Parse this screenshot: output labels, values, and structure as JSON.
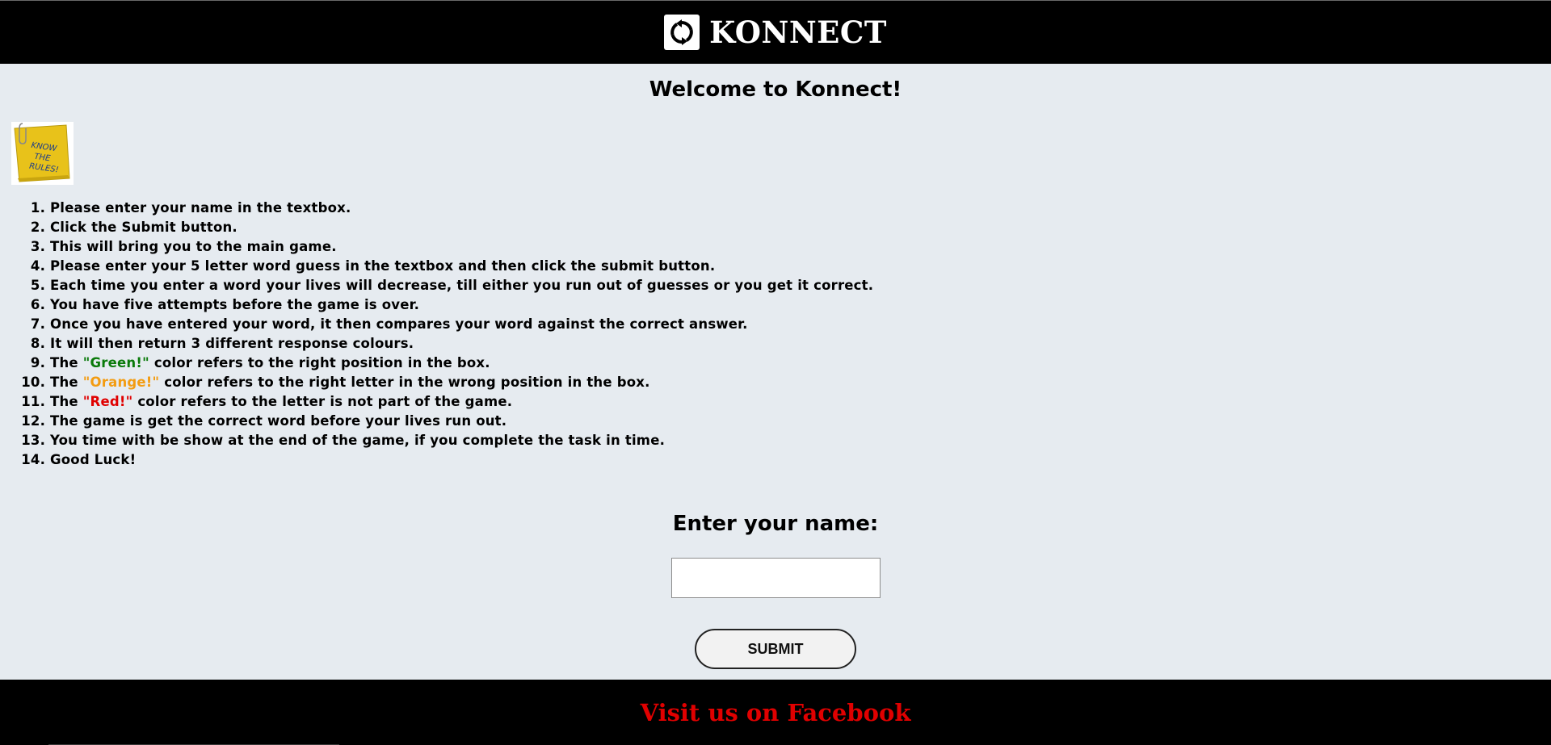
{
  "header": {
    "logo_icon": "refresh-icon",
    "title": "KONNECT"
  },
  "main": {
    "welcome": "Welcome to Konnect!",
    "rules_note_text": "Know the Rules!",
    "rules": [
      "Please enter your name in the textbox.",
      "Click the Submit button.",
      "This will bring you to the main game.",
      "Please enter your 5 letter word guess in the textbox and then click the submit button.",
      "Each time you enter a word your lives will decrease, till either you run out of guesses or you get it correct.",
      "You have five attempts before the game is over.",
      "Once you have entered your word, it then compares your word against the correct answer.",
      "It will then return 3 different response colours.",
      {
        "before": "The ",
        "highlight": "\"Green!\"",
        "after": " color refers to the right position in the box.",
        "color": "#0a7a0a"
      },
      {
        "before": "The ",
        "highlight": "\"Orange!\"",
        "after": " color refers to the right letter in the wrong position in the box.",
        "color": "#f39c12"
      },
      {
        "before": "The ",
        "highlight": "\"Red!\"",
        "after": " color refers to the letter is not part of the game.",
        "color": "#e00000"
      },
      "The game is get the correct word before your lives run out.",
      "You time with be show at the end of the game, if you complete the task in time.",
      "Good Luck!"
    ]
  },
  "form": {
    "name_label": "Enter your name:",
    "name_value": "",
    "submit_label": "SUBMIT"
  },
  "footer": {
    "link_text": "Visit us on Facebook",
    "link_color": "#e00000"
  }
}
